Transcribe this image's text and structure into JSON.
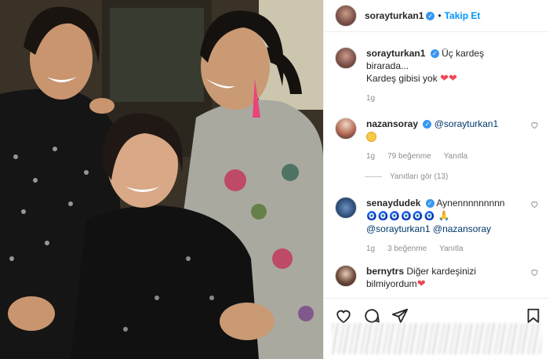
{
  "header": {
    "username": "sorayturkan1",
    "separator": "•",
    "follow_label": "Takip Et"
  },
  "caption": {
    "username": "sorayturkan1",
    "line1": "Üç kardeş birarada...",
    "line2": "Kardeş gibisi yok",
    "hearts": "❤❤",
    "time": "1g"
  },
  "comments": [
    {
      "username": "nazansoray",
      "text": "@sorayturkan1",
      "emoji": "smiling-face-with-hearts",
      "time": "1g",
      "likes": "79 beğenme",
      "reply": "Yanıtla",
      "view_replies": "Yanıtları gör (13)"
    },
    {
      "username": "senaydudek",
      "text": "Aynennnnnnnnn",
      "eyes": "🧿🧿🧿🧿🧿🧿",
      "pray": "🙏",
      "mention1": "@sorayturkan1",
      "mention2": "@nazansoray",
      "time": "1g",
      "likes": "3 beğenme",
      "reply": "Yanıtla"
    },
    {
      "username": "bernytrs",
      "text": "Diğer kardeşinizi",
      "text2": "bilmiyordum",
      "heart": "❤"
    }
  ],
  "colors": {
    "link": "#0095f6",
    "verified": "#3897f0",
    "muted": "#8e8e8e",
    "heart": "#ed4956"
  }
}
